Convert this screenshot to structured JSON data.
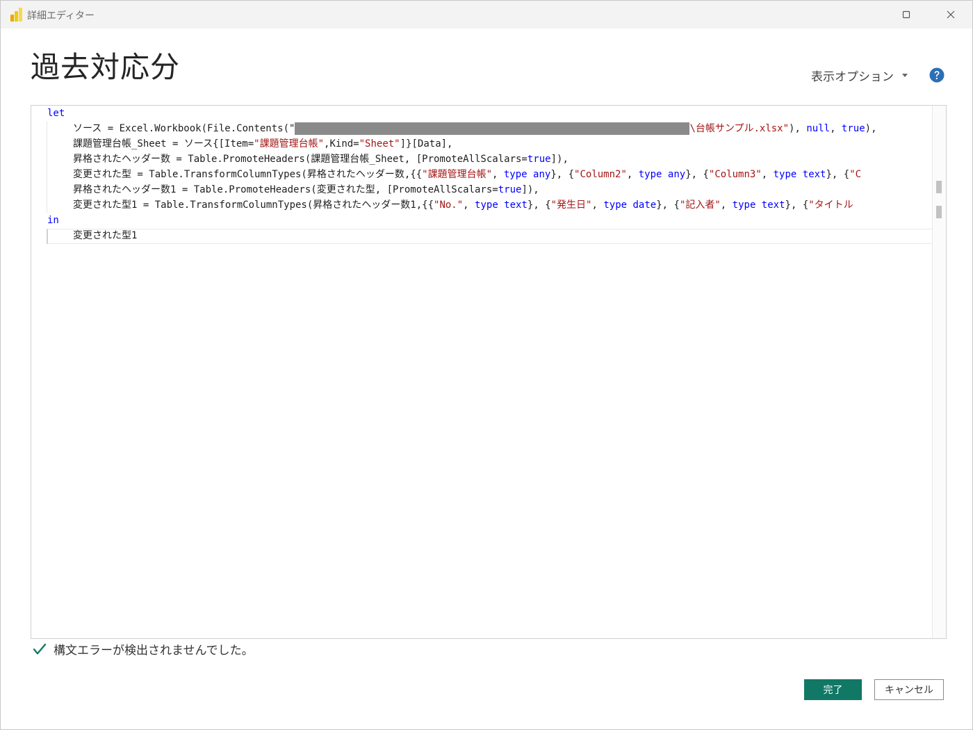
{
  "window": {
    "title": "詳細エディター"
  },
  "heading": "過去対応分",
  "toolbar": {
    "display_options": "表示オプション"
  },
  "code": {
    "l1_let": "let",
    "l2_a": "ソース = Excel.Workbook(File.Contents(\"",
    "l2_path_tail": "\\台帳サンプル.xlsx\"",
    "l2_b": "), ",
    "l2_null": "null",
    "l2_c": ", ",
    "l2_true": "true",
    "l2_d": "),",
    "l3_a": "課題管理台帳_Sheet = ソース{[Item=",
    "l3_s1": "\"課題管理台帳\"",
    "l3_b": ",Kind=",
    "l3_s2": "\"Sheet\"",
    "l3_c": "]}[Data],",
    "l4_a": "昇格されたヘッダー数 = Table.PromoteHeaders(課題管理台帳_Sheet, [PromoteAllScalars=",
    "l4_true": "true",
    "l4_b": "]),",
    "l5_a": "変更された型 = Table.TransformColumnTypes(昇格されたヘッダー数,{{",
    "l5_s1": "\"課題管理台帳\"",
    "l5_b": ", ",
    "l5_type1": "type",
    "l5_any1": " any",
    "l5_c": "}, {",
    "l5_s2": "\"Column2\"",
    "l5_d": ", ",
    "l5_type2": "type",
    "l5_any2": " any",
    "l5_e": "}, {",
    "l5_s3": "\"Column3\"",
    "l5_f": ", ",
    "l5_type3": "type",
    "l5_text3": " text",
    "l5_g": "}, {",
    "l5_s4": "\"C",
    "l6_a": "昇格されたヘッダー数1 = Table.PromoteHeaders(変更された型, [PromoteAllScalars=",
    "l6_true": "true",
    "l6_b": "]),",
    "l7_a": "変更された型1 = Table.TransformColumnTypes(昇格されたヘッダー数1,{{",
    "l7_s1": "\"No.\"",
    "l7_b": ", ",
    "l7_type1": "type",
    "l7_text1": " text",
    "l7_c": "}, {",
    "l7_s2": "\"発生日\"",
    "l7_d": ", ",
    "l7_type2": "type",
    "l7_date2": " date",
    "l7_e": "}, {",
    "l7_s3": "\"記入者\"",
    "l7_f": ", ",
    "l7_type3": "type",
    "l7_text3": " text",
    "l7_g": "}, {",
    "l7_s4": "\"タイトル",
    "l8_in": "in",
    "l9": "変更された型1"
  },
  "status": {
    "message": "構文エラーが検出されませんでした。"
  },
  "buttons": {
    "done": "完了",
    "cancel": "キャンセル"
  },
  "colors": {
    "accent": "#117865",
    "keyword": "#0000ff",
    "string": "#a31515",
    "check": "#117865"
  }
}
